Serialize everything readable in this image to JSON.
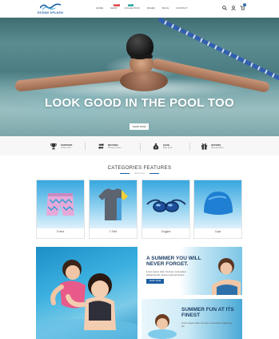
{
  "header": {
    "logo_text": "OCEAN SPLASH",
    "nav": [
      {
        "label": "HOME",
        "badge": "",
        "badge_color": ""
      },
      {
        "label": "SHOP",
        "badge": "SALE",
        "badge_color": "#e0474c"
      },
      {
        "label": "COLLECTION",
        "badge": "NEW",
        "badge_color": "#2aa7a1"
      },
      {
        "label": "PAGES",
        "badge": "",
        "badge_color": ""
      },
      {
        "label": "BLOG",
        "badge": "",
        "badge_color": ""
      },
      {
        "label": "CONTACT",
        "badge": "",
        "badge_color": ""
      }
    ],
    "icons": [
      "search-icon",
      "user-icon",
      "cart-icon"
    ],
    "cart_count": "0"
  },
  "hero": {
    "title": "LOOK GOOD IN THE POOL TOO",
    "button_label": "SHOP NOW"
  },
  "features": [
    {
      "icon": "trophy-icon",
      "title": "SUPPORT",
      "subtitle": "Online 24/7"
    },
    {
      "icon": "refresh-icon",
      "title": "RETURN",
      "subtitle": "30 days return"
    },
    {
      "icon": "money-bag-icon",
      "title": "SAVE",
      "subtitle": "Best price"
    },
    {
      "icon": "gift-icon",
      "title": "OFFERS",
      "subtitle": "Special offers"
    }
  ],
  "categories": {
    "heading": "CATEGORIES FEATURES",
    "subheading": "shop now",
    "items": [
      {
        "label": "Trunks",
        "icon": "swim-trunks-icon"
      },
      {
        "label": "T-Shirt",
        "icon": "tshirt-icon"
      },
      {
        "label": "Goggles",
        "icon": "goggles-icon"
      },
      {
        "label": "Caps",
        "icon": "swim-cap-icon"
      }
    ]
  },
  "banners": {
    "summer": {
      "title_line1": "A SUMMER YOU WILL",
      "title_line2": "NEVER FORGET.",
      "text": "Lorem ipsum dolor sit amet, consectetur adipiscing elit, sed do eiusmod tempor",
      "button_label": "SHOP NOW"
    },
    "fun": {
      "title_line1": "SUMMER FUN AT ITS",
      "title_line2": "FINEST",
      "text": "Lorem ipsum dolor sit amet, consectetur adipiscing elit"
    }
  },
  "colors": {
    "brand": "#1d5fa3",
    "sale_badge": "#e0474c",
    "new_badge": "#2aa7a1"
  }
}
